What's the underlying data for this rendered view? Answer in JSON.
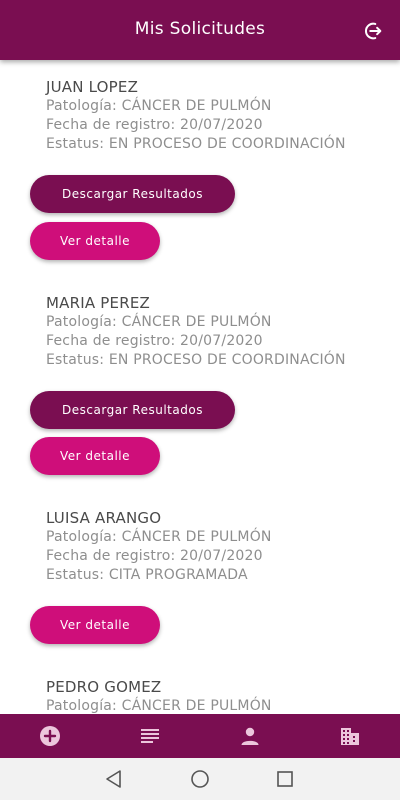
{
  "header": {
    "title": "Mis Solicitudes"
  },
  "requests": [
    {
      "name": "JUAN LOPEZ",
      "pathology": "Patología: CÁNCER DE PULMÓN",
      "date": "Fecha de registro: 20/07/2020",
      "status": "Estatus: EN PROCESO DE COORDINACIÓN",
      "download_label": "Descargar Resultados",
      "detail_label": "Ver detalle"
    },
    {
      "name": "MARIA PEREZ",
      "pathology": "Patología: CÁNCER DE PULMÓN",
      "date": "Fecha de registro: 20/07/2020",
      "status": "Estatus: EN PROCESO DE COORDINACIÓN",
      "download_label": "Descargar Resultados",
      "detail_label": "Ver detalle"
    },
    {
      "name": "LUISA ARANGO",
      "pathology": "Patología: CÁNCER DE PULMÓN",
      "date": "Fecha de registro: 20/07/2020",
      "status": "Estatus: CITA PROGRAMADA",
      "detail_label": "Ver detalle"
    },
    {
      "name": "PEDRO GOMEZ",
      "pathology": "Patología: CÁNCER DE PULMÓN"
    }
  ],
  "bottom_nav": {
    "items": [
      {
        "icon": "add-circle-icon"
      },
      {
        "icon": "list-icon"
      },
      {
        "icon": "person-icon"
      },
      {
        "icon": "building-icon"
      }
    ]
  },
  "system_nav": {
    "items": [
      {
        "icon": "back-triangle-icon"
      },
      {
        "icon": "home-circle-icon"
      },
      {
        "icon": "recents-square-icon"
      }
    ]
  },
  "colors": {
    "primary": "#7a0e51",
    "accent": "#cf0e7a",
    "name_text": "#4a4a4a",
    "info_text": "#8e8e8e"
  }
}
